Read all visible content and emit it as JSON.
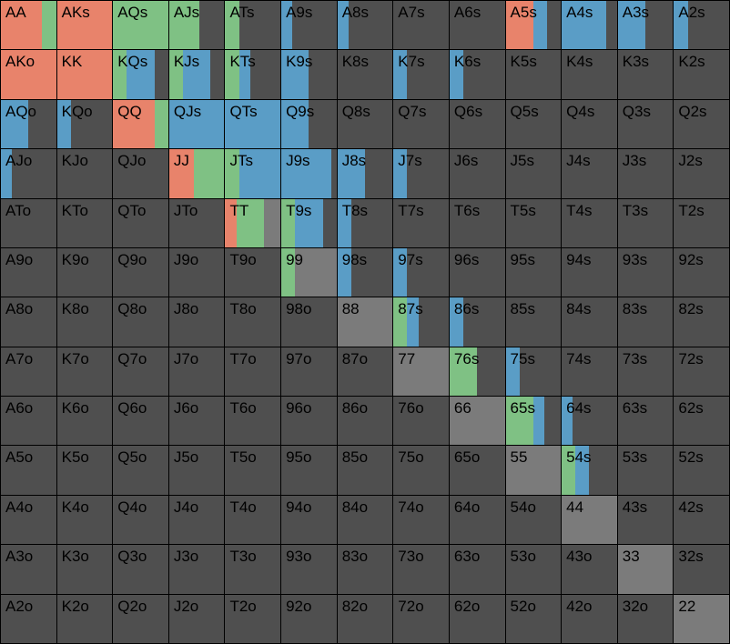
{
  "colors": {
    "raise": "#e8836b",
    "call": "#7fc184",
    "bluff": "#5a9dc6",
    "fold": "#4f4f4f",
    "pair_fold": "#7b7b7b",
    "grid_line": "#000000"
  },
  "ranks": [
    "A",
    "K",
    "Q",
    "J",
    "T",
    "9",
    "8",
    "7",
    "6",
    "5",
    "4",
    "3",
    "2"
  ],
  "hands": [
    [
      "AA",
      "AKs",
      "AQs",
      "AJs",
      "ATs",
      "A9s",
      "A8s",
      "A7s",
      "A6s",
      "A5s",
      "A4s",
      "A3s",
      "A2s"
    ],
    [
      "AKo",
      "KK",
      "KQs",
      "KJs",
      "KTs",
      "K9s",
      "K8s",
      "K7s",
      "K6s",
      "K5s",
      "K4s",
      "K3s",
      "K2s"
    ],
    [
      "AQo",
      "KQo",
      "QQ",
      "QJs",
      "QTs",
      "Q9s",
      "Q8s",
      "Q7s",
      "Q6s",
      "Q5s",
      "Q4s",
      "Q3s",
      "Q2s"
    ],
    [
      "AJo",
      "KJo",
      "QJo",
      "JJ",
      "JTs",
      "J9s",
      "J8s",
      "J7s",
      "J6s",
      "J5s",
      "J4s",
      "J3s",
      "J2s"
    ],
    [
      "ATo",
      "KTo",
      "QTo",
      "JTo",
      "TT",
      "T9s",
      "T8s",
      "T7s",
      "T6s",
      "T5s",
      "T4s",
      "T3s",
      "T2s"
    ],
    [
      "A9o",
      "K9o",
      "Q9o",
      "J9o",
      "T9o",
      "99",
      "98s",
      "97s",
      "96s",
      "95s",
      "94s",
      "93s",
      "92s"
    ],
    [
      "A8o",
      "K8o",
      "Q8o",
      "J8o",
      "T8o",
      "98o",
      "88",
      "87s",
      "86s",
      "85s",
      "84s",
      "83s",
      "82s"
    ],
    [
      "A7o",
      "K7o",
      "Q7o",
      "J7o",
      "T7o",
      "97o",
      "87o",
      "77",
      "76s",
      "75s",
      "74s",
      "73s",
      "72s"
    ],
    [
      "A6o",
      "K6o",
      "Q6o",
      "J6o",
      "T6o",
      "96o",
      "86o",
      "76o",
      "66",
      "65s",
      "64s",
      "63s",
      "62s"
    ],
    [
      "A5o",
      "K5o",
      "Q5o",
      "J5o",
      "T5o",
      "95o",
      "85o",
      "75o",
      "65o",
      "55",
      "54s",
      "53s",
      "52s"
    ],
    [
      "A4o",
      "K4o",
      "Q4o",
      "J4o",
      "T4o",
      "94o",
      "84o",
      "74o",
      "64o",
      "54o",
      "44",
      "43s",
      "42s"
    ],
    [
      "A3o",
      "K3o",
      "Q3o",
      "J3o",
      "T3o",
      "93o",
      "83o",
      "73o",
      "63o",
      "53o",
      "43o",
      "33",
      "32s"
    ],
    [
      "A2o",
      "K2o",
      "Q2o",
      "J2o",
      "T2o",
      "92o",
      "82o",
      "72o",
      "62o",
      "52o",
      "42o",
      "32o",
      "22"
    ]
  ],
  "frequencies": {
    "AA": {
      "raise": 0.75,
      "call": 0.25,
      "bluff": 0
    },
    "AKs": {
      "raise": 1.0,
      "call": 0,
      "bluff": 0
    },
    "AQs": {
      "raise": 0,
      "call": 1.0,
      "bluff": 0
    },
    "AJs": {
      "raise": 0,
      "call": 0.55,
      "bluff": 0
    },
    "ATs": {
      "raise": 0,
      "call": 0.25,
      "bluff": 0
    },
    "A9s": {
      "raise": 0,
      "call": 0,
      "bluff": 0.2
    },
    "A8s": {
      "raise": 0,
      "call": 0,
      "bluff": 0.2
    },
    "A5s": {
      "raise": 0.5,
      "call": 0,
      "bluff": 0.25
    },
    "A4s": {
      "raise": 0,
      "call": 0,
      "bluff": 0.8
    },
    "A3s": {
      "raise": 0,
      "call": 0,
      "bluff": 0.5
    },
    "A2s": {
      "raise": 0,
      "call": 0,
      "bluff": 0.25
    },
    "AKo": {
      "raise": 1.0,
      "call": 0,
      "bluff": 0
    },
    "KK": {
      "raise": 1.0,
      "call": 0,
      "bluff": 0
    },
    "KQs": {
      "raise": 0,
      "call": 0.25,
      "bluff": 0.5
    },
    "KJs": {
      "raise": 0,
      "call": 0.25,
      "bluff": 0.5
    },
    "KTs": {
      "raise": 0,
      "call": 0.25,
      "bluff": 0.2
    },
    "K9s": {
      "raise": 0,
      "call": 0,
      "bluff": 0.5
    },
    "K7s": {
      "raise": 0,
      "call": 0,
      "bluff": 0.25
    },
    "K6s": {
      "raise": 0,
      "call": 0,
      "bluff": 0.25
    },
    "AQo": {
      "raise": 0,
      "call": 0,
      "bluff": 0.5
    },
    "KQo": {
      "raise": 0,
      "call": 0,
      "bluff": 0.25
    },
    "QQ": {
      "raise": 0.75,
      "call": 0.25,
      "bluff": 0
    },
    "QJs": {
      "raise": 0,
      "call": 0,
      "bluff": 1.0
    },
    "QTs": {
      "raise": 0,
      "call": 0,
      "bluff": 1.0
    },
    "Q9s": {
      "raise": 0,
      "call": 0,
      "bluff": 0.5
    },
    "AJo": {
      "raise": 0,
      "call": 0,
      "bluff": 0.2
    },
    "JJ": {
      "raise": 0.45,
      "call": 0.55,
      "bluff": 0
    },
    "JTs": {
      "raise": 0,
      "call": 0.25,
      "bluff": 0.75
    },
    "J9s": {
      "raise": 0,
      "call": 0,
      "bluff": 0.9
    },
    "J8s": {
      "raise": 0,
      "call": 0,
      "bluff": 0.5
    },
    "J7s": {
      "raise": 0,
      "call": 0,
      "bluff": 0.25
    },
    "TT": {
      "raise": 0.2,
      "call": 0.5,
      "bluff": 0
    },
    "T9s": {
      "raise": 0,
      "call": 0.25,
      "bluff": 0.5
    },
    "T8s": {
      "raise": 0,
      "call": 0,
      "bluff": 0.25
    },
    "99": {
      "raise": 0,
      "call": 0.25,
      "bluff": 0
    },
    "98s": {
      "raise": 0,
      "call": 0,
      "bluff": 0.25
    },
    "97s": {
      "raise": 0,
      "call": 0,
      "bluff": 0.25
    },
    "87s": {
      "raise": 0,
      "call": 0.25,
      "bluff": 0.2
    },
    "86s": {
      "raise": 0,
      "call": 0,
      "bluff": 0.25
    },
    "76s": {
      "raise": 0,
      "call": 0.5,
      "bluff": 0
    },
    "75s": {
      "raise": 0,
      "call": 0,
      "bluff": 0.25
    },
    "65s": {
      "raise": 0,
      "call": 0.5,
      "bluff": 0.2
    },
    "64s": {
      "raise": 0,
      "call": 0,
      "bluff": 0.2
    },
    "54s": {
      "raise": 0,
      "call": 0.25,
      "bluff": 0.25
    }
  }
}
